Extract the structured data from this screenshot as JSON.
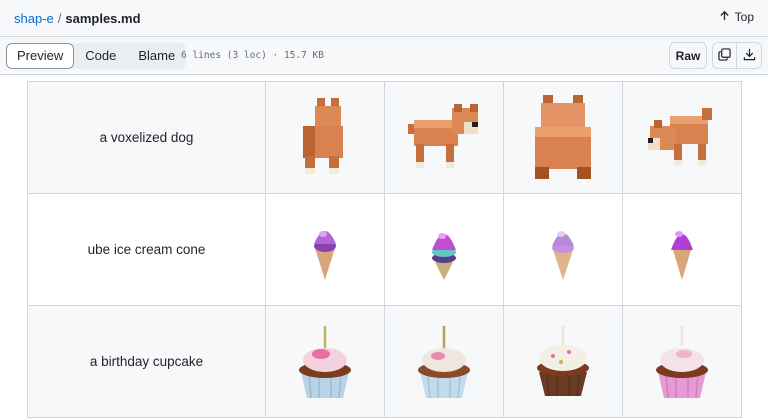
{
  "breadcrumb": {
    "repo": "shap-e",
    "separator": "/",
    "file": "samples.md"
  },
  "header": {
    "top_label": "Top",
    "top_icon": "arrow-up-icon"
  },
  "toolbar": {
    "tabs": [
      {
        "label": "Preview"
      },
      {
        "label": "Code"
      },
      {
        "label": "Blame"
      }
    ],
    "active_tab": "Preview",
    "file_info": "6 lines (3 loc) · 15.7 KB",
    "raw_label": "Raw",
    "copy_icon": "copy-icon",
    "download_icon": "download-icon"
  },
  "rows": [
    {
      "prompt": "a voxelized dog"
    },
    {
      "prompt": "ube ice cream cone"
    },
    {
      "prompt": "a birthday cupcake"
    }
  ],
  "colors": {
    "link": "#0969da",
    "border": "#d0d7de",
    "dog": "#d9824f",
    "ube_scoop": "#b566d6",
    "cone": "#d9a679",
    "cupcake_frosting": "#f3d2dd",
    "cupcake_wrapper_blue": "#b8d2e6",
    "cupcake_wrapper_pink": "#e79ad6"
  }
}
